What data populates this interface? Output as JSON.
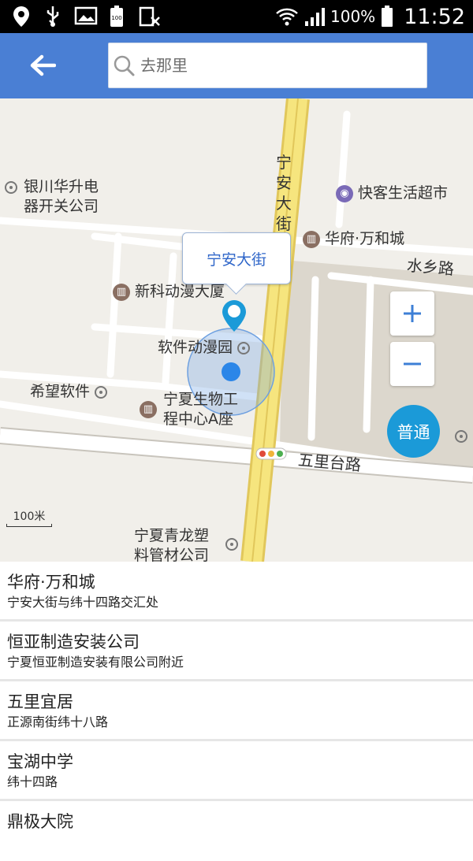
{
  "status_bar": {
    "battery_percent": "100%",
    "time": "11:52",
    "left_icons": [
      "location-icon",
      "usb-icon",
      "image-icon",
      "battery-100-icon",
      "no-sim-icon"
    ],
    "right_icons": [
      "wifi-icon",
      "signal-icon",
      "battery-icon"
    ]
  },
  "header": {
    "background": "#4a7fd4",
    "search_placeholder": "去那里"
  },
  "map": {
    "callout": "宁安大街",
    "roads": {
      "ningan_street": "宁安大街",
      "shuixiang_road": "水乡路",
      "wulitai_road": "五里台路"
    },
    "pois": {
      "yinchuan": [
        "银川华升电",
        "器开关公司"
      ],
      "kuaike": "快客生活超市",
      "huafu": "华府·万和城",
      "xinke": "新科动漫大厦",
      "software_park": "软件动漫园",
      "xiwang": "希望软件",
      "ningxia_bio": [
        "宁夏生物工",
        "程中心A座"
      ],
      "qinglong": [
        "宁夏青龙塑",
        "料管材公司"
      ]
    },
    "zoom_in": "+",
    "zoom_out": "−",
    "mode_button": "普通",
    "scale": "100米",
    "accent": "#1b9ad8"
  },
  "results": [
    {
      "name": "华府·万和城",
      "address": "宁安大街与纬十四路交汇处"
    },
    {
      "name": "恒亚制造安装公司",
      "address": "宁夏恒亚制造安装有限公司附近"
    },
    {
      "name": "五里宜居",
      "address": "正源南街纬十八路"
    },
    {
      "name": "宝湖中学",
      "address": "纬十四路"
    },
    {
      "name": "鼎极大院",
      "address": ""
    }
  ]
}
